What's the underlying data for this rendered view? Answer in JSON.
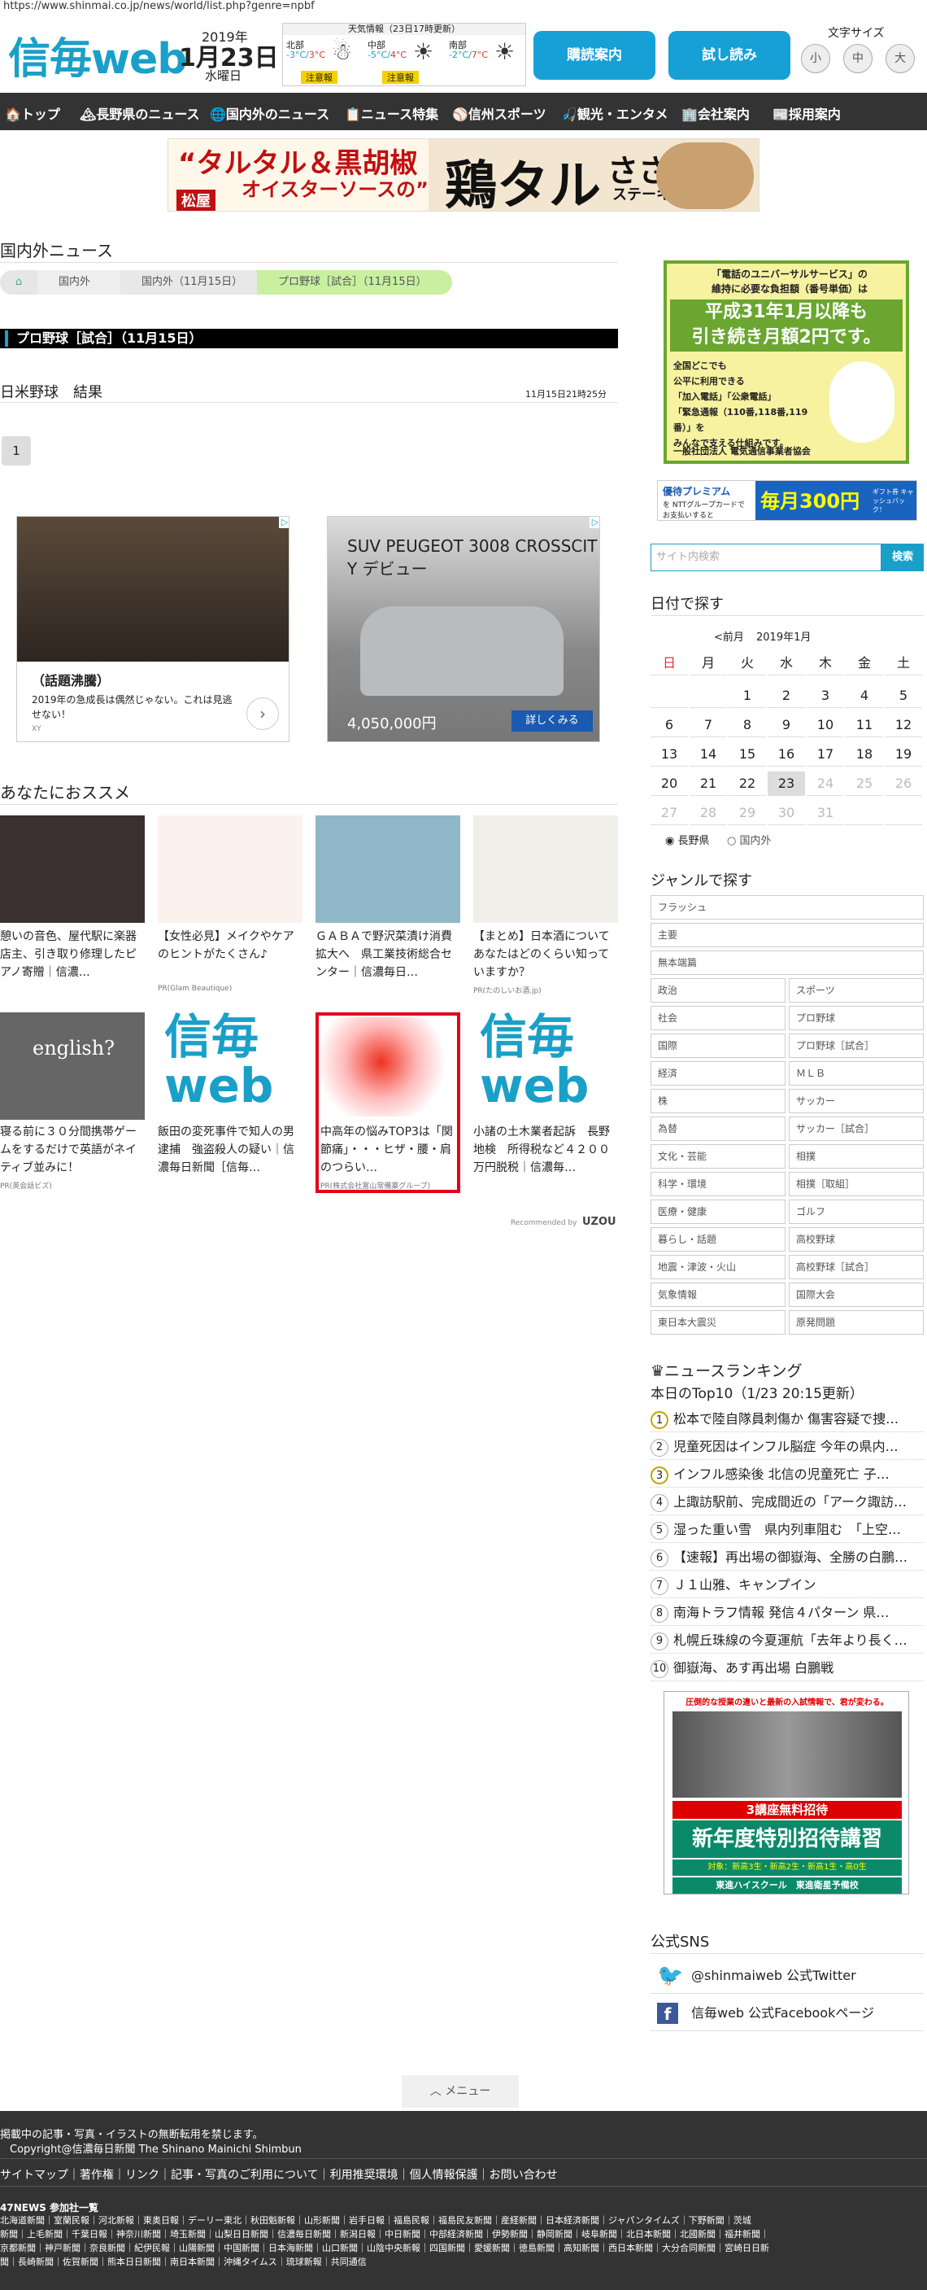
{
  "url": "https://www.shinmai.co.jp/news/world/list.php?genre=npbf",
  "header": {
    "logo": "信毎web",
    "year": "2019年",
    "date": "1月23日",
    "weekday": "水曜日",
    "weather_title": "天気情報（23日17時更新）",
    "weather": [
      {
        "region": "北部",
        "low": "-3°C",
        "high": "3°C",
        "icon": "cloud-snow-icon",
        "warning": "注意報"
      },
      {
        "region": "中部",
        "low": "-5°C",
        "high": "4°C",
        "icon": "sun-icon",
        "warning": "注意報"
      },
      {
        "region": "南部",
        "low": "-2°C",
        "high": "7°C",
        "icon": "sun-icon",
        "warning": ""
      }
    ],
    "btn_delivery": "購読案内",
    "btn_trial": "試し読み",
    "fontsize_label": "文字サイズ",
    "fontsizes": [
      "小",
      "中",
      "大"
    ]
  },
  "nav": [
    "🏠トップ",
    "🏔長野県のニュース",
    "🌐国内外のニュース",
    "📋ニュース特集",
    "⚾信州スポーツ",
    "🎣観光・エンタメ",
    "🏢会社案内",
    "📰採用案内"
  ],
  "banner": {
    "line1": "“タルタル＆黒胡椒",
    "line2": "オイスターソースの”",
    "big": "鶏タル",
    "sub": "ささみ",
    "sub2": "ステーキ定食",
    "brand": "松屋"
  },
  "main": {
    "section_title": "国内外ニュース",
    "breadcrumb": [
      "国内外",
      "国内外（11月15日）",
      "プロ野球［試合］（11月15日）"
    ],
    "category_bar": "プロ野球［試合］（11月15日）",
    "article_title": "日米野球　結果",
    "article_time": "11月15日21時25分",
    "page": "1",
    "ads": [
      {
        "title": "（話題沸騰）",
        "text": "2019年の急成長は偶然じゃない。これは見逃せない！",
        "src": "XY"
      },
      {
        "title": "SUV PEUGEOT 3008 CROSSCITY デビュー",
        "price": "4,050,000円",
        "cta": "詳しくみる"
      }
    ],
    "recommend_title": "あなたにおススメ",
    "recommend": [
      {
        "title": "憩いの音色、屋代駅に楽器店主、引き取り修理したピアノ寄贈｜信濃…",
        "pr": ""
      },
      {
        "title": "【女性必見】メイクやケアのヒントがたくさん♪",
        "pr": "PR(Glam Beautique)"
      },
      {
        "title": "ＧＡＢＡで野沢菜漬け消費拡大へ　県工業技術総合センター｜信濃毎日…",
        "pr": ""
      },
      {
        "title": "【まとめ】日本酒についてあなたはどのくらい知っていますか？",
        "pr": "PR(たのしいお酒.jp)"
      },
      {
        "title": "寝る前に３０分間携帯ゲームをするだけで英語がネイティブ並みに！",
        "pr": "PR(英会話ビズ)"
      },
      {
        "title": "飯田の変死事件で知人の男逮捕　強盗殺人の疑い｜信濃毎日新聞［信毎…",
        "pr": ""
      },
      {
        "title": "中高年の悩みTOP3は「関節痛」・・・ヒザ・腰・肩のつらい…",
        "pr": "PR(株式会社富山常備薬グループ)"
      },
      {
        "title": "小諸の土木業者起訴　長野地検　所得税など４２００万円脱税｜信濃毎…",
        "pr": ""
      }
    ],
    "recommended_by": "Recommended by",
    "uzou": "UZOU"
  },
  "sidebar": {
    "ad1": {
      "l1": "「電話のユニバーサルサービス」の",
      "l2": "維持に必要な負担額（番号単価）は",
      "big1": "平成31年1月以降も",
      "big2": "引き続き月額2円です。",
      "t1": "全国どこでも",
      "t2": "公平に利用できる",
      "t3": "「加入電話」「公衆電話」",
      "t4": "「緊急通報（110番,118番,119番）」を",
      "t5": "みんなで支える仕組みです。",
      "org": "一般社団法人 電気通信事業者協会"
    },
    "ad2": {
      "brand": "優待プレミアム",
      "text": "を NTTグループカードで お支払いすると",
      "big": "毎月300円",
      "sub": "ギフト券 キャッシュバック！"
    },
    "search_placeholder": "サイト内検索",
    "search_button": "検索",
    "date_title": "日付で探す",
    "cal_prev": "<前月",
    "cal_month": "2019年1月",
    "cal_week": [
      "日",
      "月",
      "火",
      "水",
      "木",
      "金",
      "土"
    ],
    "cal_days": [
      "",
      "",
      "1",
      "2",
      "3",
      "4",
      "5",
      "6",
      "7",
      "8",
      "9",
      "10",
      "11",
      "12",
      "13",
      "14",
      "15",
      "16",
      "17",
      "18",
      "19",
      "20",
      "21",
      "22",
      "23",
      "24",
      "25",
      "26",
      "27",
      "28",
      "29",
      "30",
      "31",
      "",
      ""
    ],
    "radio": [
      "長野県",
      "国内外"
    ],
    "genre_title": "ジャンルで探す",
    "genres_wide": [
      "フラッシュ",
      "主要",
      "無本端篇"
    ],
    "genres": [
      "政治",
      "スポーツ",
      "社会",
      "プロ野球",
      "国際",
      "プロ野球［試合］",
      "経済",
      "ＭＬＢ",
      "株",
      "サッカー",
      "為替",
      "サッカー［試合］",
      "文化・芸能",
      "相撲",
      "科学・環境",
      "相撲［取組］",
      "医療・健康",
      "ゴルフ",
      "暮らし・話題",
      "高校野球",
      "地震・津波・火山",
      "高校野球［試合］",
      "気象情報",
      "国際大会",
      "東日本大震災",
      "原発問題"
    ],
    "ranking_title": "ニュースランキング",
    "ranking_sub": "本日のTop10（1/23 20:15更新）",
    "ranking": [
      "松本で陸自隊員刺傷か 傷害容疑で捜…",
      "児童死因はインフル脳症 今年の県内…",
      "インフル感染後 北信の児童死亡 子…",
      "上諏訪駅前、完成間近の「アーク諏訪…",
      "湿った重い雪　県内列車阻む　「上空…",
      "【速報】再出場の御嶽海、全勝の白鵬…",
      "Ｊ１山雅、キャンプイン",
      "南海トラフ情報 発信４パターン 県…",
      "札幌丘珠線の今夏運航「去年より長く…",
      "御嶽海、あす再出場 白鵬戦"
    ],
    "ad3": {
      "top": "圧倒的な授業の違いと最新の入試情報で、君が変わる。",
      "invite": "3講座無料招待",
      "big": "新年度特別招待講習",
      "target": "対象：新高3生・新高2生・新高1生・高0生",
      "brand": "東進ハイスクール　東進衛星予備校"
    },
    "sns_title": "公式SNS",
    "sns": [
      "@shinmaiweb 公式Twitter",
      "信毎web 公式Facebookページ"
    ]
  },
  "menu_button": "メニュー",
  "footer": {
    "notice": "掲載中の記事・写真・イラストの無断転用を禁じます。",
    "copyright": "Copyright@信濃毎日新聞 The Shinano Mainichi Shimbun",
    "links": "サイトマップ｜著作権｜リンク｜記事・写真のご利用について｜利用推奨環境｜個人情報保護｜お問い合わせ",
    "np_title": "47NEWS 参加社一覧",
    "np1": "北海道新聞｜室蘭民報｜河北新報｜東奥日報｜デーリー東北｜秋田魁新報｜山形新聞｜岩手日報｜福島民報｜福島民友新聞｜産経新聞｜日本経済新聞｜ジャパンタイムズ｜下野新聞｜茨城",
    "np2": "新聞｜上毛新聞｜千葉日報｜神奈川新聞｜埼玉新聞｜山梨日日新聞｜信濃毎日新聞｜新潟日報｜中日新聞｜中部経済新聞｜伊勢新聞｜静岡新聞｜岐阜新聞｜北日本新聞｜北國新聞｜福井新聞｜",
    "np3": "京都新聞｜神戸新聞｜奈良新聞｜紀伊民報｜山陽新聞｜中国新聞｜日本海新聞｜山口新聞｜山陰中央新報｜四国新聞｜愛媛新聞｜徳島新聞｜高知新聞｜西日本新聞｜大分合同新聞｜宮崎日日新",
    "np4": "聞｜長崎新聞｜佐賀新聞｜熊本日日新聞｜南日本新聞｜沖縄タイムス｜琉球新報｜共同通信"
  },
  "colors": {
    "brand": "#1aa0c8",
    "nav": "#333333",
    "highlight": "#c8f0a0",
    "ad_border": "#e2001a"
  }
}
